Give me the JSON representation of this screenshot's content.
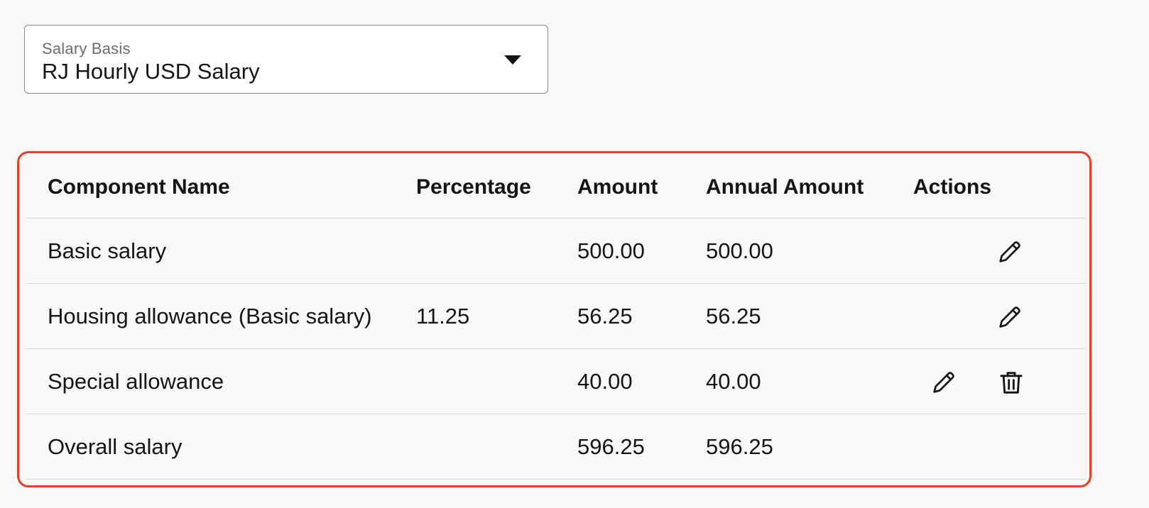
{
  "salary_basis": {
    "label": "Salary Basis",
    "value": "RJ Hourly USD Salary",
    "caret_icon": "chevron-down-icon"
  },
  "table": {
    "headers": {
      "component_name": "Component Name",
      "percentage": "Percentage",
      "amount": "Amount",
      "annual_amount": "Annual Amount",
      "actions": "Actions"
    },
    "rows": [
      {
        "name": "Basic salary",
        "percentage": "",
        "amount": "500.00",
        "annual_amount": "500.00",
        "actions": [
          "edit"
        ]
      },
      {
        "name": "Housing allowance (Basic salary)",
        "percentage": "11.25",
        "amount": "56.25",
        "annual_amount": "56.25",
        "actions": [
          "edit"
        ]
      },
      {
        "name": "Special allowance",
        "percentage": "",
        "amount": "40.00",
        "annual_amount": "40.00",
        "actions": [
          "edit",
          "delete"
        ]
      },
      {
        "name": "Overall salary",
        "percentage": "",
        "amount": "596.25",
        "annual_amount": "596.25",
        "actions": []
      }
    ],
    "highlight_color": "#e5402b"
  }
}
